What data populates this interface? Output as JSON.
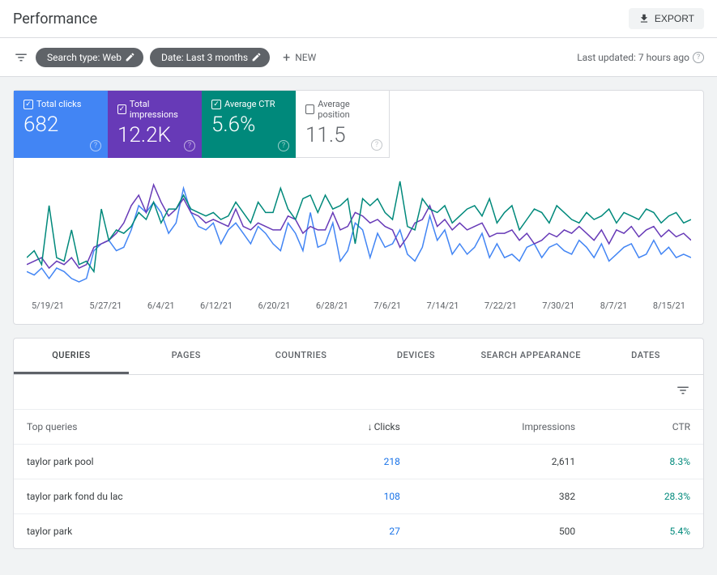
{
  "header": {
    "title": "Performance",
    "export_label": "EXPORT"
  },
  "filters": {
    "chip_search_type": "Search type: Web",
    "chip_date": "Date: Last 3 months",
    "new_label": "NEW",
    "last_updated": "Last updated: 7 hours ago"
  },
  "metrics": {
    "clicks": {
      "label": "Total clicks",
      "value": "682",
      "checked": true
    },
    "impressions": {
      "label": "Total impressions",
      "value": "12.2K",
      "checked": true
    },
    "ctr": {
      "label": "Average CTR",
      "value": "5.6%",
      "checked": true
    },
    "position": {
      "label": "Average position",
      "value": "11.5",
      "checked": false
    }
  },
  "chart_data": {
    "type": "line",
    "x_labels": [
      "5/19/21",
      "5/27/21",
      "6/4/21",
      "6/12/21",
      "6/20/21",
      "6/28/21",
      "7/6/21",
      "7/14/21",
      "7/22/21",
      "7/30/21",
      "8/7/21",
      "8/15/21"
    ],
    "series": [
      {
        "name": "Total clicks",
        "color": "#4285f4",
        "values": [
          6,
          5,
          7,
          4,
          7,
          6,
          4,
          3,
          4,
          12,
          14,
          15,
          12,
          13,
          18,
          25,
          23,
          26,
          23,
          17,
          20,
          30,
          23,
          19,
          18,
          20,
          14,
          18,
          20,
          17,
          14,
          19,
          17,
          14,
          12,
          20,
          17,
          12,
          23,
          13,
          14,
          20,
          9,
          12,
          20,
          18,
          10,
          17,
          13,
          14,
          18,
          11,
          9,
          13,
          22,
          15,
          18,
          11,
          14,
          11,
          13,
          17,
          10,
          14,
          10,
          11,
          9,
          13,
          14,
          10,
          13,
          14,
          12,
          11,
          15,
          13,
          10,
          14,
          9,
          11,
          13,
          14,
          10,
          11,
          15,
          11,
          13,
          10,
          11,
          10
        ]
      },
      {
        "name": "Total impressions",
        "color": "#673ab7",
        "values": [
          8,
          9,
          10,
          7,
          9,
          8,
          10,
          7,
          8,
          13,
          14,
          15,
          17,
          20,
          25,
          28,
          23,
          31,
          26,
          22,
          24,
          27,
          23,
          22,
          20,
          21,
          20,
          19,
          24,
          19,
          18,
          20,
          19,
          18,
          18,
          22,
          21,
          17,
          19,
          18,
          18,
          23,
          18,
          19,
          23,
          22,
          20,
          21,
          19,
          18,
          13,
          16,
          20,
          21,
          25,
          19,
          21,
          18,
          20,
          18,
          19,
          20,
          16,
          17,
          17,
          18,
          15,
          17,
          14,
          15,
          17,
          16,
          18,
          17,
          19,
          17,
          15,
          18,
          14,
          18,
          17,
          19,
          16,
          18,
          19,
          16,
          18,
          16,
          17,
          15
        ]
      },
      {
        "name": "Average CTR",
        "color": "#00897b",
        "values": [
          10,
          12,
          8,
          25,
          10,
          9,
          18,
          8,
          9,
          6,
          24,
          15,
          18,
          17,
          19,
          23,
          21,
          26,
          20,
          24,
          24,
          28,
          24,
          23,
          22,
          23,
          21,
          22,
          26,
          23,
          20,
          26,
          23,
          23,
          30,
          24,
          21,
          27,
          28,
          23,
          28,
          24,
          25,
          27,
          14,
          27,
          25,
          27,
          23,
          21,
          32,
          19,
          18,
          27,
          24,
          23,
          25,
          20,
          22,
          24,
          25,
          22,
          27,
          20,
          23,
          25,
          18,
          21,
          24,
          23,
          20,
          25,
          23,
          21,
          20,
          23,
          21,
          22,
          24,
          20,
          23,
          22,
          21,
          24,
          23,
          20,
          22,
          23,
          20,
          21
        ]
      }
    ],
    "y_range": [
      0,
      35
    ]
  },
  "tabs": [
    "QUERIES",
    "PAGES",
    "COUNTRIES",
    "DEVICES",
    "SEARCH APPEARANCE",
    "DATES"
  ],
  "active_tab": 0,
  "table": {
    "headers": {
      "queries": "Top queries",
      "clicks": "Clicks",
      "impressions": "Impressions",
      "ctr": "CTR"
    },
    "sort_col": "clicks",
    "rows": [
      {
        "query": "taylor park pool",
        "clicks": "218",
        "impressions": "2,611",
        "ctr": "8.3%"
      },
      {
        "query": "taylor park fond du lac",
        "clicks": "108",
        "impressions": "382",
        "ctr": "28.3%"
      },
      {
        "query": "taylor park",
        "clicks": "27",
        "impressions": "500",
        "ctr": "5.4%"
      }
    ]
  }
}
